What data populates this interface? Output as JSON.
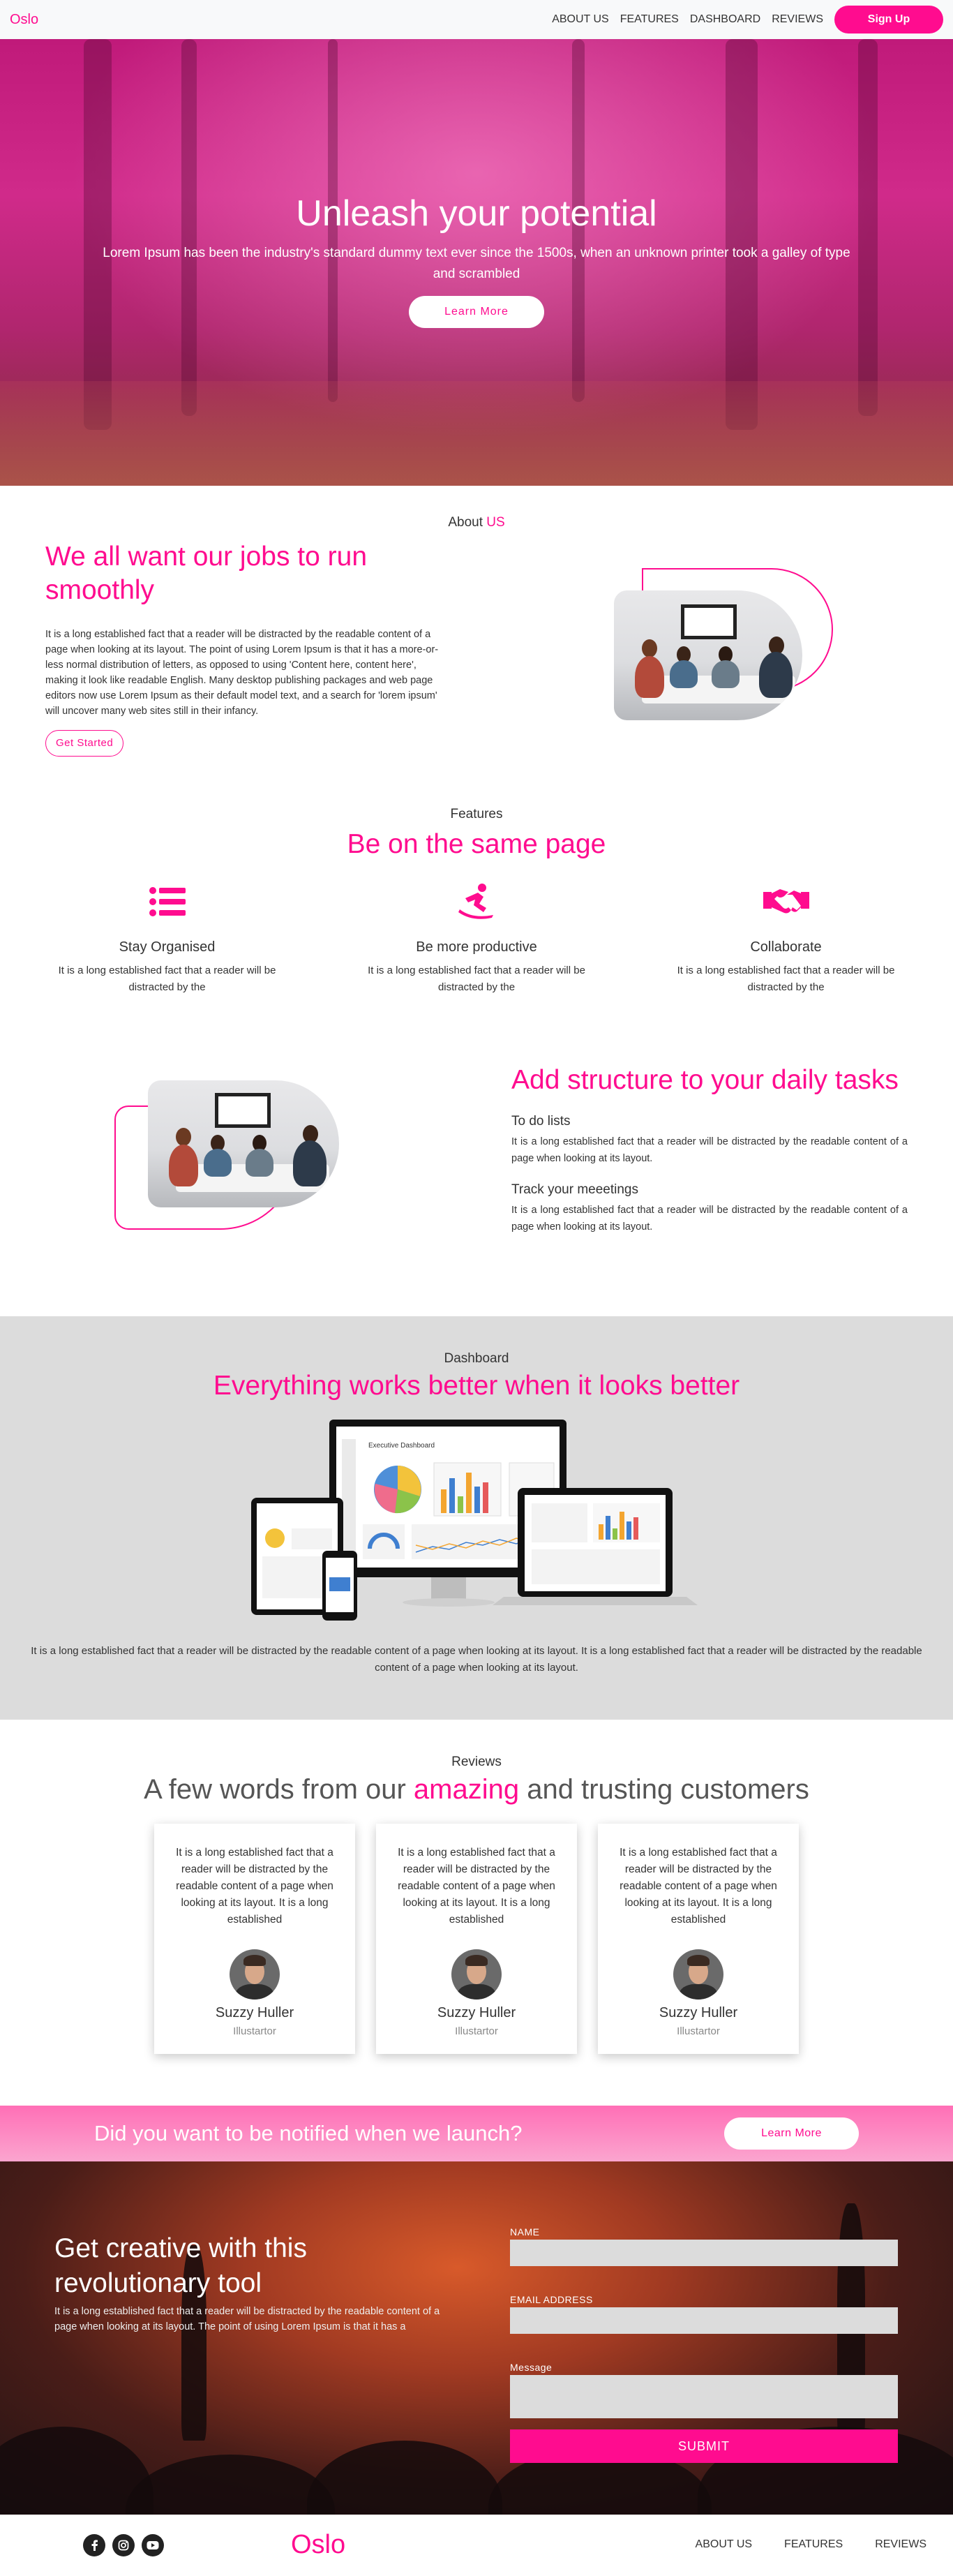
{
  "nav": {
    "brand": "Oslo",
    "links": [
      "ABOUT US",
      "FEATURES",
      "DASHBOARD",
      "REVIEWS"
    ],
    "signup_label": "Sign Up"
  },
  "hero": {
    "title": "Unleash your potential",
    "subtitle": "Lorem Ipsum has been the industry's standard dummy text ever since the 1500s, when an unknown printer took a galley of type and scrambled",
    "button_label": "Learn More"
  },
  "about": {
    "eyebrow_prefix": "About ",
    "eyebrow_accent": "US",
    "title": "We all want our jobs to run smoothly",
    "body": "It is a long established fact that a reader will be distracted by the readable content of a page when looking at its layout. The point of using Lorem Ipsum is that it has a more-or-less normal distribution of letters, as opposed to using 'Content here, content here', making it look like readable English. Many desktop publishing packages and web page editors now use Lorem Ipsum as their default model text, and a search for 'lorem ipsum' will uncover many web sites still in their infancy.",
    "button_label": "Get Started"
  },
  "features": {
    "eyebrow": "Features",
    "title": "Be on the same page",
    "items": [
      {
        "icon": "list-icon",
        "title": "Stay Organised",
        "text": "It is a long established fact that a reader will be distracted by the"
      },
      {
        "icon": "snowboarder-icon",
        "title": "Be more productive",
        "text": "It is a long established fact that a reader will be distracted by the"
      },
      {
        "icon": "handshake-icon",
        "title": "Collaborate",
        "text": "It is a long established fact that a reader will be distracted by the"
      }
    ]
  },
  "structure": {
    "title": "Add structure to your daily tasks",
    "items": [
      {
        "heading": "To do lists",
        "text": "It is a long established fact that a reader will be distracted by the readable content of a page when looking at its layout."
      },
      {
        "heading": "Track your meeetings",
        "text": "It is a long established fact that a reader will be distracted by the readable content of a page when looking at its layout."
      }
    ]
  },
  "dashboard": {
    "eyebrow": "Dashboard",
    "title": "Everything works better when it looks better",
    "screen_title": "Executive Dashboard",
    "caption": "It is a long established fact that a reader will be distracted by the readable content of a page when looking at its layout. It is a long established fact that a reader will be distracted by the readable content of a page when looking at its layout."
  },
  "reviews": {
    "eyebrow": "Reviews",
    "title_before": "A few words from our ",
    "title_accent": "amazing",
    "title_after": " and trusting customers",
    "items": [
      {
        "text": "It is a long established fact that a reader will be distracted by the readable content of a page when looking at its layout. It is a long established",
        "name": "Suzzy Huller",
        "role": "Illustartor"
      },
      {
        "text": "It is a long established fact that a reader will be distracted by the readable content of a page when looking at its layout. It is a long established",
        "name": "Suzzy Huller",
        "role": "Illustartor"
      },
      {
        "text": "It is a long established fact that a reader will be distracted by the readable content of a page when looking at its layout. It is a long established",
        "name": "Suzzy Huller",
        "role": "Illustartor"
      }
    ]
  },
  "notify": {
    "text": "Did you want to be notified when we launch?",
    "button_label": "Learn More"
  },
  "contact": {
    "title": "Get creative with this revolutionary tool",
    "body": "It is a long established fact that a reader will be distracted by the readable content of a page when looking at its layout. The point of using Lorem Ipsum is that it has a",
    "name_label": "NAME",
    "email_label": "EMAIL ADDRESS",
    "message_label": "Message",
    "submit_label": "SUBMIT"
  },
  "footer": {
    "brand": "Oslo",
    "socials": [
      "facebook-icon",
      "instagram-icon",
      "youtube-icon"
    ],
    "links": [
      "ABOUT US",
      "FEATURES",
      "REVIEWS"
    ]
  },
  "colors": {
    "accent": "#ff0c8f",
    "dashboard_bg": "#dcdcdc",
    "notify_bg": "#ff6fb6"
  }
}
